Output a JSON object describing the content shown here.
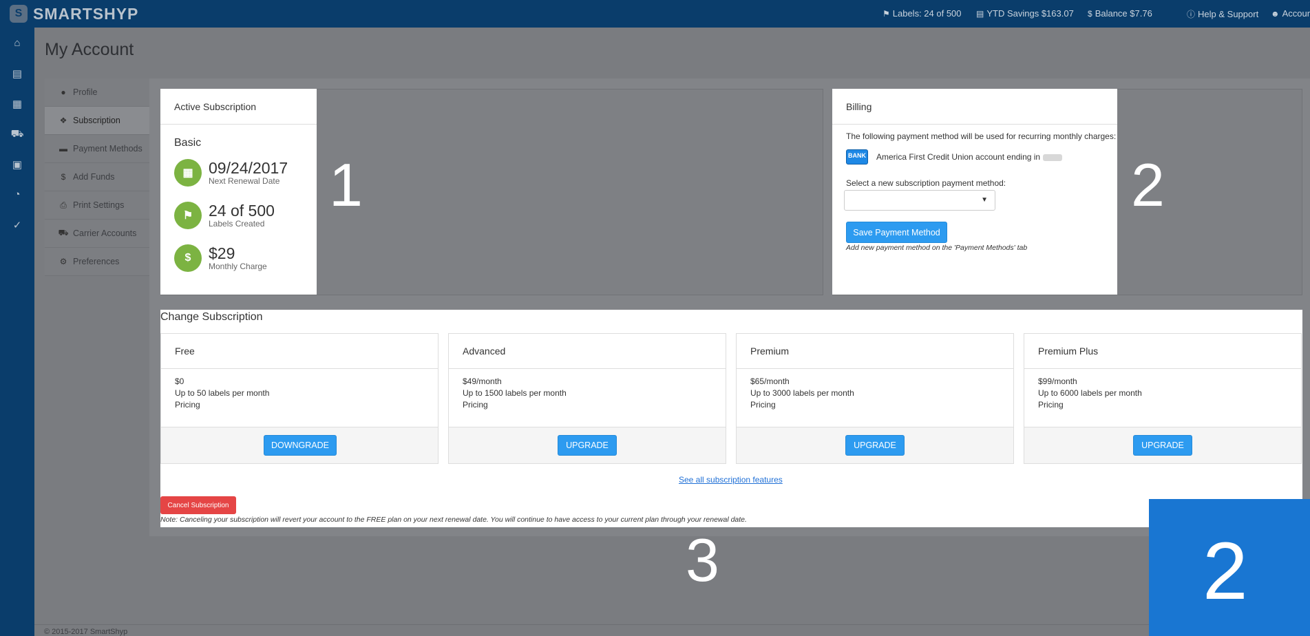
{
  "app": {
    "logo_text": "SMARTSHYP",
    "logo_mark": "S"
  },
  "topbar": {
    "labels": "Labels: 24 of 500",
    "ytd_savings": "YTD Savings $163.07",
    "balance": "Balance $7.76",
    "help": "Help & Support",
    "account": "Account"
  },
  "rail": {
    "icons": [
      "home-icon",
      "store-icon",
      "calendar-icon",
      "truck-icon",
      "address-book-icon",
      "pie-chart-icon",
      "cart-icon"
    ]
  },
  "page": {
    "title": "My Account"
  },
  "subnav": {
    "items": [
      {
        "label": "Profile",
        "icon": "user-icon"
      },
      {
        "label": "Subscription",
        "icon": "ticket-icon"
      },
      {
        "label": "Payment Methods",
        "icon": "credit-card-icon"
      },
      {
        "label": "Add Funds",
        "icon": "dollar-icon"
      },
      {
        "label": "Print Settings",
        "icon": "printer-icon"
      },
      {
        "label": "Carrier Accounts",
        "icon": "truck-icon"
      },
      {
        "label": "Preferences",
        "icon": "gears-icon"
      }
    ],
    "active": "Subscription"
  },
  "active_subscription": {
    "header": "Active Subscription",
    "plan": "Basic",
    "renewal_date": "09/24/2017",
    "renewal_label": "Next Renewal Date",
    "labels_value": "24 of 500",
    "labels_label": "Labels Created",
    "charge_value": "$29",
    "charge_label": "Monthly Charge"
  },
  "billing": {
    "header": "Billing",
    "intro": "The following payment method will be used for recurring monthly charges:",
    "bank_logo": "BANK",
    "account_text": "America First Credit Union account ending in",
    "select_label": "Select a new subscription payment method:",
    "save_button": "Save Payment Method",
    "note": "Add new payment method on the 'Payment Methods' tab"
  },
  "change_subscription": {
    "title": "Change Subscription",
    "plans": [
      {
        "name": "Free",
        "price": "$0",
        "limit": "Up to 50 labels per month",
        "pricing": "Pricing",
        "button": "DOWNGRADE"
      },
      {
        "name": "Advanced",
        "price": "$49/month",
        "limit": "Up to 1500 labels per month",
        "pricing": "Pricing",
        "button": "UPGRADE"
      },
      {
        "name": "Premium",
        "price": "$65/month",
        "limit": "Up to 3000 labels per month",
        "pricing": "Pricing",
        "button": "UPGRADE"
      },
      {
        "name": "Premium Plus",
        "price": "$99/month",
        "limit": "Up to 6000 labels per month",
        "pricing": "Pricing",
        "button": "UPGRADE"
      }
    ],
    "features_link": "See all subscription features",
    "cancel_button": "Cancel Subscription",
    "cancel_note": "Note: Canceling your subscription will revert your account to the FREE plan on your next renewal date. You will continue to have access to your current plan through your renewal date."
  },
  "overlay_numbers": {
    "n1": "1",
    "n2": "2",
    "n3": "3",
    "n4": "2"
  },
  "footer": {
    "copyright": "© 2015-2017 SmartShyp"
  },
  "colors": {
    "topbar": "#0a3d6b",
    "accent": "#2d9bf0",
    "stat_green": "#7cb342",
    "danger": "#e54545",
    "highlight_box": "#1976d2"
  }
}
